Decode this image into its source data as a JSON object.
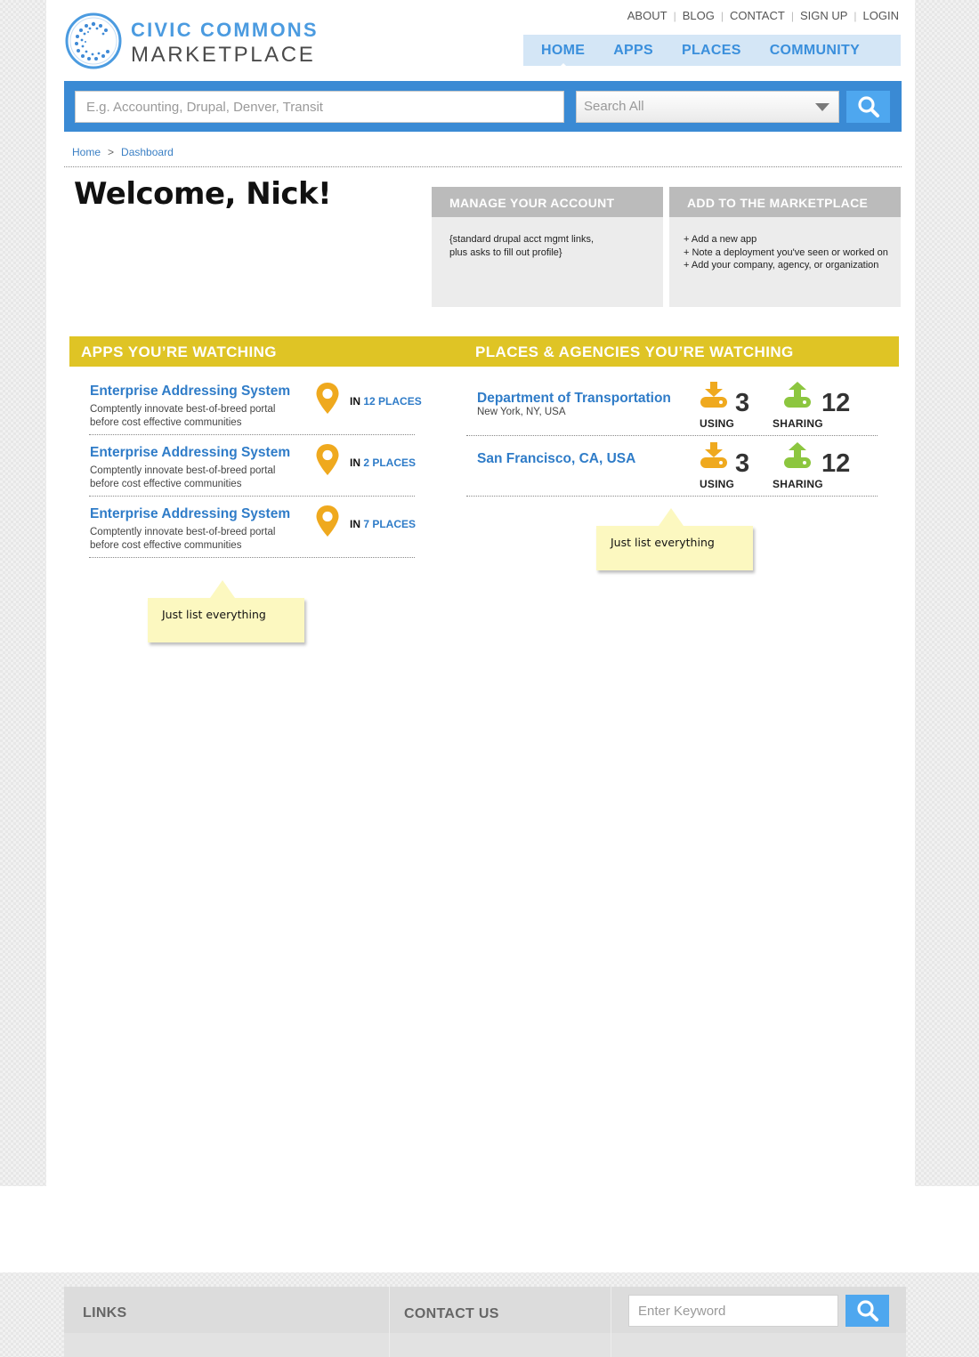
{
  "brand": {
    "line1": "CIVIC COMMONS",
    "line2": "MARKETPLACE",
    "accent": "#4b9be0"
  },
  "topnav": {
    "items": [
      "ABOUT",
      "BLOG",
      "CONTACT",
      "SIGN UP",
      "LOGIN"
    ]
  },
  "mainnav": {
    "items": [
      "HOME",
      "APPS",
      "PLACES",
      "COMMUNITY"
    ],
    "active": "HOME"
  },
  "search": {
    "placeholder": "E.g. Accounting, Drupal, Denver, Transit",
    "scope": "Search All",
    "button_icon": "search-icon"
  },
  "breadcrumb": {
    "home": "Home",
    "separator": ">",
    "current": "Dashboard"
  },
  "welcome": "Welcome, Nick!",
  "panels": {
    "account": {
      "title": "MANAGE YOUR ACCOUNT",
      "lines": [
        "{standard drupal acct mgmt links,",
        "plus asks to fill out profile}"
      ]
    },
    "add": {
      "title": "ADD TO THE MARKETPLACE",
      "lines": [
        "+ Add a new app",
        "+ Note a deployment you've seen or worked on",
        "+ Add your company, agency, or organization"
      ]
    }
  },
  "watching": {
    "apps_title": "APPS YOU’RE WATCHING",
    "places_title": "PLACES & AGENCIES YOU’RE WATCHING",
    "bar_color": "#dfc425"
  },
  "apps": [
    {
      "title": "Enterprise Addressing System",
      "desc": "Comptently innovate best-of-breed portal before cost effective communities",
      "in": "IN",
      "count": "12 PLACES"
    },
    {
      "title": "Enterprise Addressing System",
      "desc": "Comptently innovate best-of-breed portal before cost effective communities",
      "in": "IN",
      "count": "2 PLACES"
    },
    {
      "title": "Enterprise Addressing System",
      "desc": "Comptently innovate best-of-breed portal before cost effective communities",
      "in": "IN",
      "count": "7 PLACES"
    }
  ],
  "places": [
    {
      "title": "Department of Transportation",
      "sub": "New York, NY, USA",
      "using": "3",
      "using_label": "USING",
      "sharing": "12",
      "sharing_label": "SHARING"
    },
    {
      "title": "San Francisco, CA, USA",
      "sub": "",
      "using": "3",
      "using_label": "USING",
      "sharing": "12",
      "sharing_label": "SHARING"
    }
  ],
  "notes": {
    "apps": "Just list everything",
    "places": "Just list everything"
  },
  "footer": {
    "links": "LINKS",
    "contact": "CONTACT US",
    "placeholder": "Enter Keyword"
  }
}
